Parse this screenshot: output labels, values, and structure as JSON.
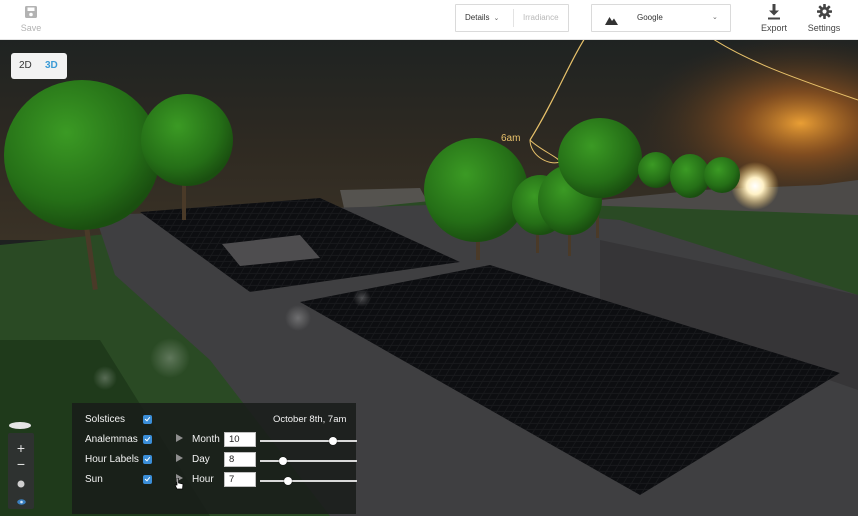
{
  "toolbar": {
    "save_label": "Save",
    "details_label": "Details",
    "irradiance_label": "Irradiance",
    "map_provider": "Google",
    "export_label": "Export",
    "settings_label": "Settings"
  },
  "view_toggle": {
    "mode_2d": "2D",
    "mode_3d": "3D",
    "active": "3D"
  },
  "map_controls": {
    "zoom_in": "+",
    "zoom_out": "−"
  },
  "scene": {
    "sun_path_label": "6am"
  },
  "panel": {
    "datetime": "October 8th, 7am",
    "checkboxes": [
      {
        "label": "Solstices",
        "checked": true
      },
      {
        "label": "Analemmas",
        "checked": true
      },
      {
        "label": "Hour Labels",
        "checked": true
      },
      {
        "label": "Sun",
        "checked": true
      }
    ],
    "sliders": [
      {
        "label": "Month",
        "value": "10",
        "fraction": 0.75
      },
      {
        "label": "Day",
        "value": "8",
        "fraction": 0.24
      },
      {
        "label": "Hour",
        "value": "7",
        "fraction": 0.29
      }
    ]
  },
  "colors": {
    "accent": "#3b9bd6",
    "checkbox": "#3b8ed8",
    "sun_path": "#e7c16a",
    "tree": "#2f7a1f",
    "grass": "#2c5226",
    "panel_bg": "#181c1a"
  }
}
